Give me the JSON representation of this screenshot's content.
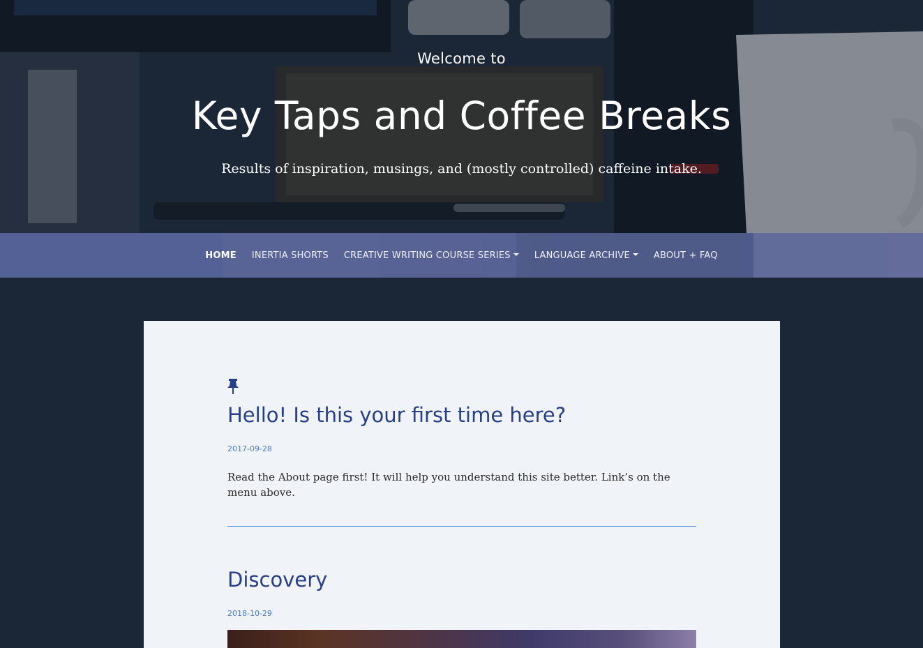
{
  "hero": {
    "pretitle": "Welcome to",
    "title": "Key Taps and Coffee Breaks",
    "tagline": "Results of inspiration, musings, and (mostly controlled) caffeine intake."
  },
  "nav": {
    "items": [
      {
        "label": "HOME",
        "active": true,
        "dropdown": false
      },
      {
        "label": "INERTIA SHORTS",
        "active": false,
        "dropdown": false
      },
      {
        "label": "CREATIVE WRITING COURSE SERIES",
        "active": false,
        "dropdown": true
      },
      {
        "label": "LANGUAGE ARCHIVE",
        "active": false,
        "dropdown": true
      },
      {
        "label": "ABOUT + FAQ",
        "active": false,
        "dropdown": false
      }
    ]
  },
  "posts": [
    {
      "pinned": true,
      "title": "Hello! Is this your first time here?",
      "date": "2017-09-28",
      "excerpt": "Read the About page first! It will help you understand this site better. Link’s on the menu above."
    },
    {
      "pinned": false,
      "title": "Discovery",
      "date": "2018-10-29"
    }
  ],
  "colors": {
    "page_bg": "#1b2736",
    "card_bg": "#f0f3f8",
    "title_blue": "#273f86",
    "date_blue": "#4a7bc4",
    "divider_blue": "#4a8ad0"
  }
}
